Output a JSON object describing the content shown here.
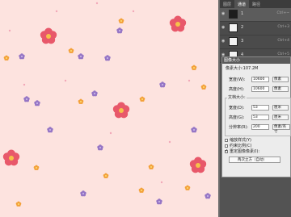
{
  "panel": {
    "tabs": [
      "图层",
      "通道",
      "路径"
    ],
    "active_tab": 1,
    "layers": [
      {
        "name": "1",
        "ctrl": "Ctrl+~",
        "dark": true
      },
      {
        "name": "2",
        "ctrl": "Ctrl+3",
        "dark": false
      },
      {
        "name": "3",
        "ctrl": "Ctrl+4",
        "dark": false
      },
      {
        "name": "4",
        "ctrl": "Ctrl+5",
        "dark": false
      },
      {
        "name": "5",
        "ctrl": "Ctrl+6",
        "dark": false
      }
    ]
  },
  "dialog": {
    "title": "图像大小",
    "pixel_size_label": "像素大小:107.2M",
    "width_label": "宽度(W):",
    "width_value": "10600",
    "width_unit": "像素",
    "height_label": "高度(H):",
    "height_value": "10600",
    "height_unit": "像素",
    "doc_size_label": "文档大小:",
    "doc_width_label": "宽度(D):",
    "doc_width_value": "53",
    "doc_width_unit": "厘米",
    "doc_height_label": "高度(G):",
    "doc_height_value": "53",
    "doc_height_unit": "厘米",
    "resolution_label": "分辨率(R):",
    "resolution_value": "200",
    "resolution_unit": "像素/英寸",
    "scale_styles_label": "缩放样式(Y)",
    "constrain_label": "约束比例(C)",
    "resample_label": "重定图像像素(I):",
    "resample_method": "两次立方（自动）"
  },
  "colors": {
    "canvas_bg": "#fde3df",
    "flower_big": "#e8586a",
    "flower_purple": "#9575c5",
    "flower_orange": "#f3a13a"
  }
}
